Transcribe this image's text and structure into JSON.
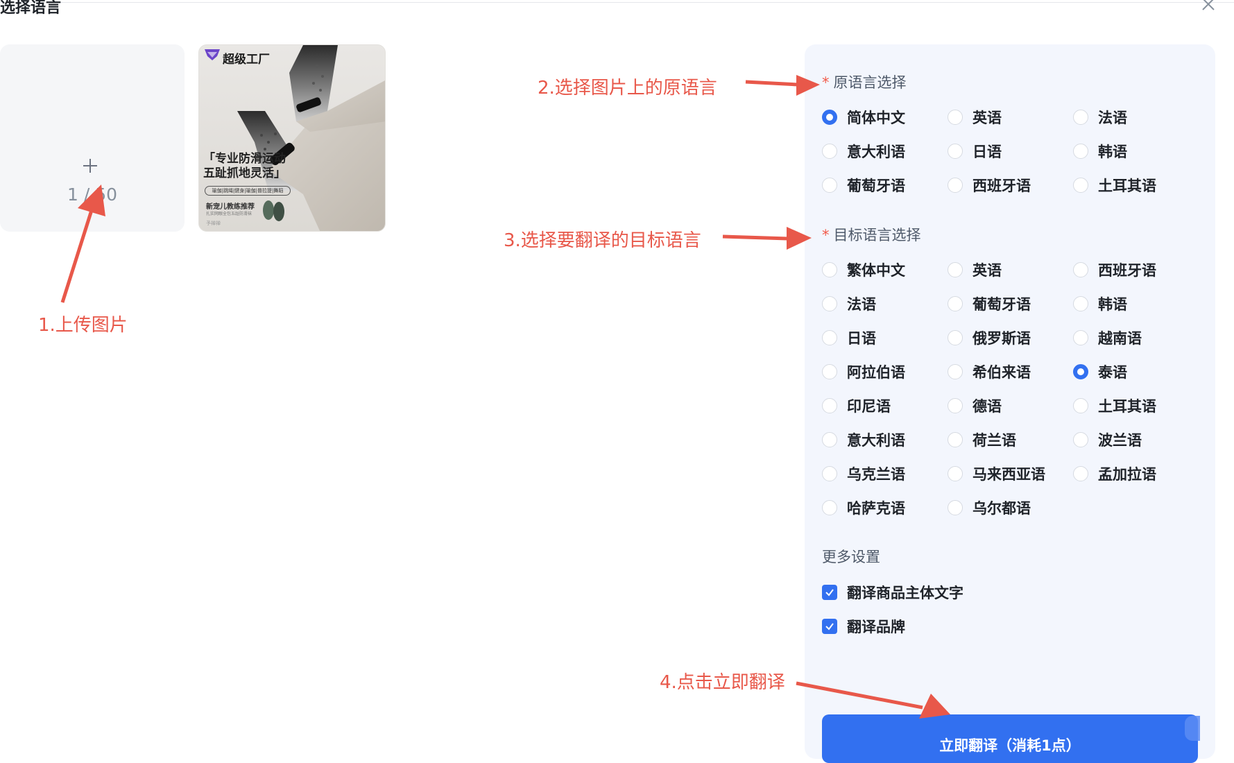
{
  "dialog": {
    "title": "选择语言"
  },
  "upload": {
    "count_label": "1 / 50"
  },
  "thumbnail": {
    "brand": "超级工厂",
    "heading_line1": "「专业防滑运动",
    "heading_line2": "五趾抓地灵活」",
    "tags": "瑜伽|跳绳|健身|瑜伽|普拉提|舞蹈",
    "recommend": "新宠儿教练推荐",
    "note": "扎实网眼全包五趾防滑袜",
    "brand_small": "予禅禅"
  },
  "annotations": {
    "step1": "1.上传图片",
    "step2": "2.选择图片上的原语言",
    "step3": "3.选择要翻译的目标语言",
    "step4": "4.点击立即翻译"
  },
  "source_language": {
    "title": "原语言选择",
    "required_mark": "*",
    "options": [
      "简体中文",
      "英语",
      "法语",
      "意大利语",
      "日语",
      "韩语",
      "葡萄牙语",
      "西班牙语",
      "土耳其语"
    ],
    "selected": "简体中文"
  },
  "target_language": {
    "title": "目标语言选择",
    "required_mark": "*",
    "options": [
      "繁体中文",
      "英语",
      "西班牙语",
      "法语",
      "葡萄牙语",
      "韩语",
      "日语",
      "俄罗斯语",
      "越南语",
      "阿拉伯语",
      "希伯来语",
      "泰语",
      "印尼语",
      "德语",
      "土耳其语",
      "意大利语",
      "荷兰语",
      "波兰语",
      "乌克兰语",
      "马来西亚语",
      "孟加拉语",
      "哈萨克语",
      "乌尔都语"
    ],
    "selected": "泰语"
  },
  "more_settings": {
    "title": "更多设置",
    "options": [
      {
        "label": "翻译商品主体文字",
        "checked": true
      },
      {
        "label": "翻译品牌",
        "checked": true
      }
    ]
  },
  "action": {
    "translate_label": "立即翻译（消耗1点）"
  },
  "colors": {
    "primary": "#3270f0",
    "annotation": "#e8584a",
    "panel_bg": "#f3f6fd"
  }
}
